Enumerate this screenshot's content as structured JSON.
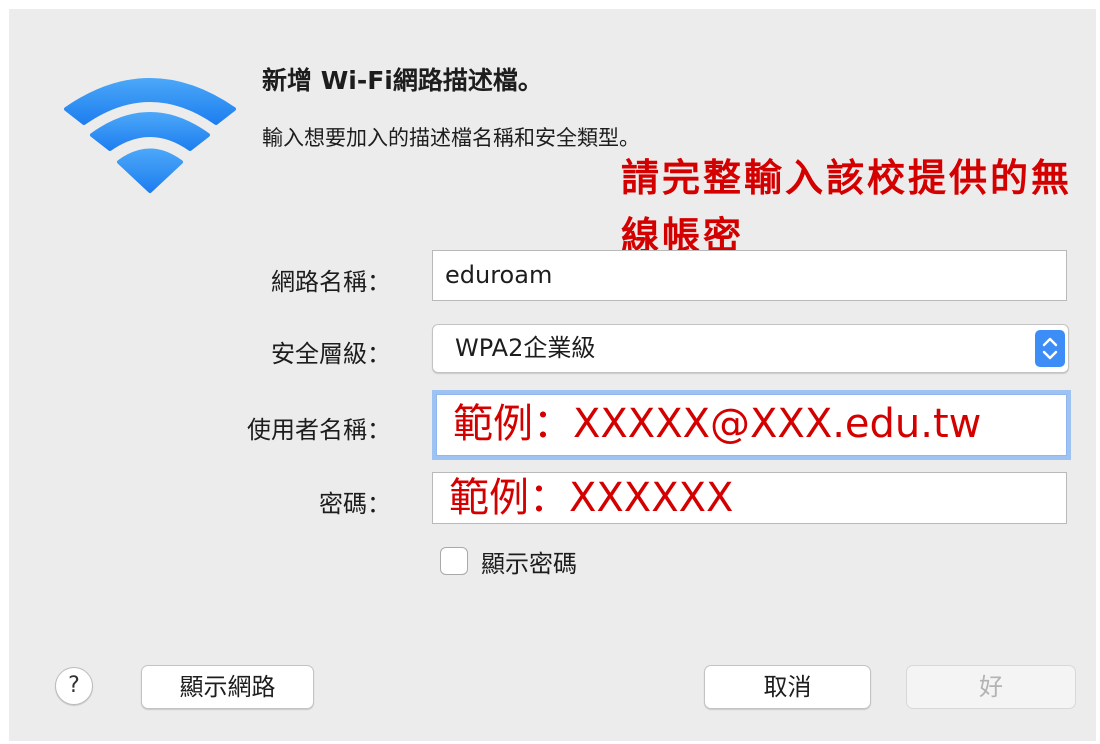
{
  "dialog": {
    "title": "新增 Wi-Fi網路描述檔。",
    "subtitle": "輸入想要加入的描述檔名稱和安全類型。",
    "annotation": "請完整輸入該校提供的無線帳密"
  },
  "form": {
    "network_name_label": "網路名稱：",
    "network_name_value": "eduroam",
    "security_label": "安全層級：",
    "security_value": "WPA2企業級",
    "username_label": "使用者名稱：",
    "username_value": "範例：XXXXX@XXX.edu.tw",
    "password_label": "密碼：",
    "password_value": "範例：XXXXXX",
    "show_password_label": "顯示密碼",
    "show_password_checked": false
  },
  "buttons": {
    "help_label": "?",
    "show_networks_label": "顯示網路",
    "cancel_label": "取消",
    "ok_label": "好"
  },
  "colors": {
    "accent": "#3d8df7",
    "annotation_red": "#d40000",
    "wifi_blue": "#2f8ff5"
  },
  "icons": {
    "wifi": "wifi-icon",
    "stepper": "up-down-chevron-icon"
  }
}
